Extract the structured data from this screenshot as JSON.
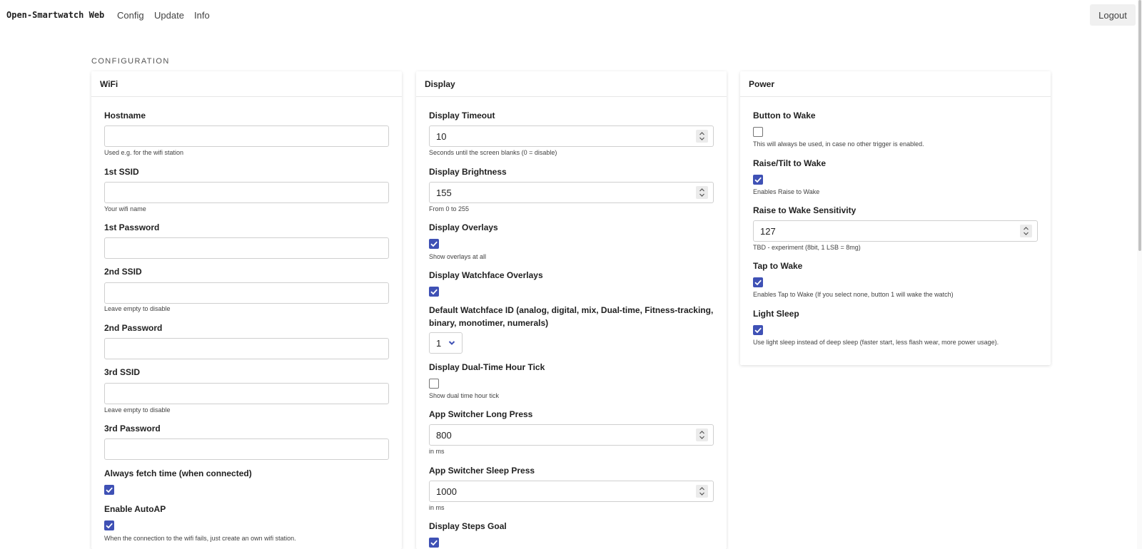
{
  "nav": {
    "brand": "Open-Smartwatch Web",
    "links": [
      "Config",
      "Update",
      "Info"
    ],
    "logout": "Logout"
  },
  "section_title": "CONFIGURATION",
  "wifi": {
    "title": "WiFi",
    "hostname": {
      "label": "Hostname",
      "value": "",
      "hint": "Used e.g. for the wifi station"
    },
    "ssid1": {
      "label": "1st SSID",
      "value": "",
      "hint": "Your wifi name"
    },
    "password1": {
      "label": "1st Password",
      "value": ""
    },
    "ssid2": {
      "label": "2nd SSID",
      "value": "",
      "hint": "Leave empty to disable"
    },
    "password2": {
      "label": "2nd Password",
      "value": ""
    },
    "ssid3": {
      "label": "3rd SSID",
      "value": "",
      "hint": "Leave empty to disable"
    },
    "password3": {
      "label": "3rd Password",
      "value": ""
    },
    "fetch_time": {
      "label": "Always fetch time (when connected)",
      "checked": true
    },
    "autoap": {
      "label": "Enable AutoAP",
      "checked": true,
      "hint": "When the connection to the wifi fails, just create an own wifi station."
    }
  },
  "display": {
    "title": "Display",
    "timeout": {
      "label": "Display Timeout",
      "value": "10",
      "hint": "Seconds until the screen blanks (0 = disable)"
    },
    "brightness": {
      "label": "Display Brightness",
      "value": "155",
      "hint": "From 0 to 255"
    },
    "overlays": {
      "label": "Display Overlays",
      "checked": true,
      "hint": "Show overlays at all"
    },
    "watchface_overlays": {
      "label": "Display Watchface Overlays",
      "checked": true
    },
    "default_watchface": {
      "label_line1": "Default Watchface ID (analog, digital, mix, Dual-time, Fitness-tracking,",
      "label_line2": "binary, monotimer, numerals)",
      "value": "1"
    },
    "dual_time_tick": {
      "label": "Display Dual-Time Hour Tick",
      "checked": false,
      "hint": "Show dual time hour tick"
    },
    "long_press": {
      "label": "App Switcher Long Press",
      "value": "800",
      "hint": "in ms"
    },
    "sleep_press": {
      "label": "App Switcher Sleep Press",
      "value": "1000",
      "hint": "in ms"
    },
    "steps_goal": {
      "label": "Display Steps Goal",
      "checked": true
    }
  },
  "power": {
    "title": "Power",
    "button_wake": {
      "label": "Button to Wake",
      "checked": false,
      "hint": "This will always be used, in case no other trigger is enabled."
    },
    "raise_wake": {
      "label": "Raise/Tilt to Wake",
      "checked": true,
      "hint": "Enables Raise to Wake"
    },
    "raise_sensitivity": {
      "label": "Raise to Wake Sensitivity",
      "value": "127",
      "hint": "TBD - experiment (8bit, 1 LSB = 8mg)"
    },
    "tap_wake": {
      "label": "Tap to Wake",
      "checked": true,
      "hint": "Enables Tap to Wake (If you select none, button 1 will wake the watch)"
    },
    "light_sleep": {
      "label": "Light Sleep",
      "checked": true,
      "hint": "Use light sleep instead of deep sleep (faster start, less flash wear, more power usage)."
    }
  },
  "colors": {
    "accent": "#3f51b5",
    "border": "#cfcfcf"
  }
}
